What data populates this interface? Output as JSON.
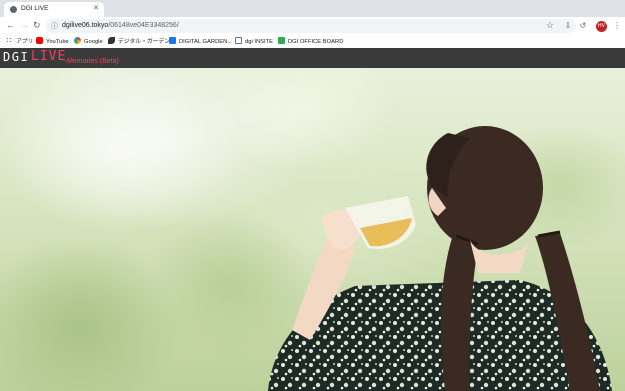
{
  "browser": {
    "tab_title": "DGI LIVE",
    "url_host": "dgilive06.tokyo",
    "url_path": "/06148ve04E3348256/",
    "profile_initials": "HV"
  },
  "bookmarks": [
    {
      "label": "アプリ",
      "icon": "apps-grid-icon",
      "color": "#e8453c"
    },
    {
      "label": "YouTube",
      "icon": "youtube-icon",
      "color": "#ff0000"
    },
    {
      "label": "Google",
      "icon": "google-icon",
      "color": "#4285f4"
    },
    {
      "label": "デジタル・ガーデン",
      "icon": "leaf-icon",
      "color": "#333333"
    },
    {
      "label": "DIGITAL GARDEN...",
      "icon": "facebook-icon",
      "color": "#1877f2"
    },
    {
      "label": "dgi INSITE",
      "icon": "document-icon",
      "color": "#4a78c2"
    },
    {
      "label": "DGI OFFICE BOARD",
      "icon": "plus-square-icon",
      "color": "#34a853"
    }
  ],
  "site": {
    "logo_dgi": "DGI",
    "logo_live": "LIVE",
    "logo_subtitle": "~Memories (Beta)"
  },
  "colors": {
    "accent": "#ff3b5c",
    "header_bg": "#3a3a3a"
  }
}
